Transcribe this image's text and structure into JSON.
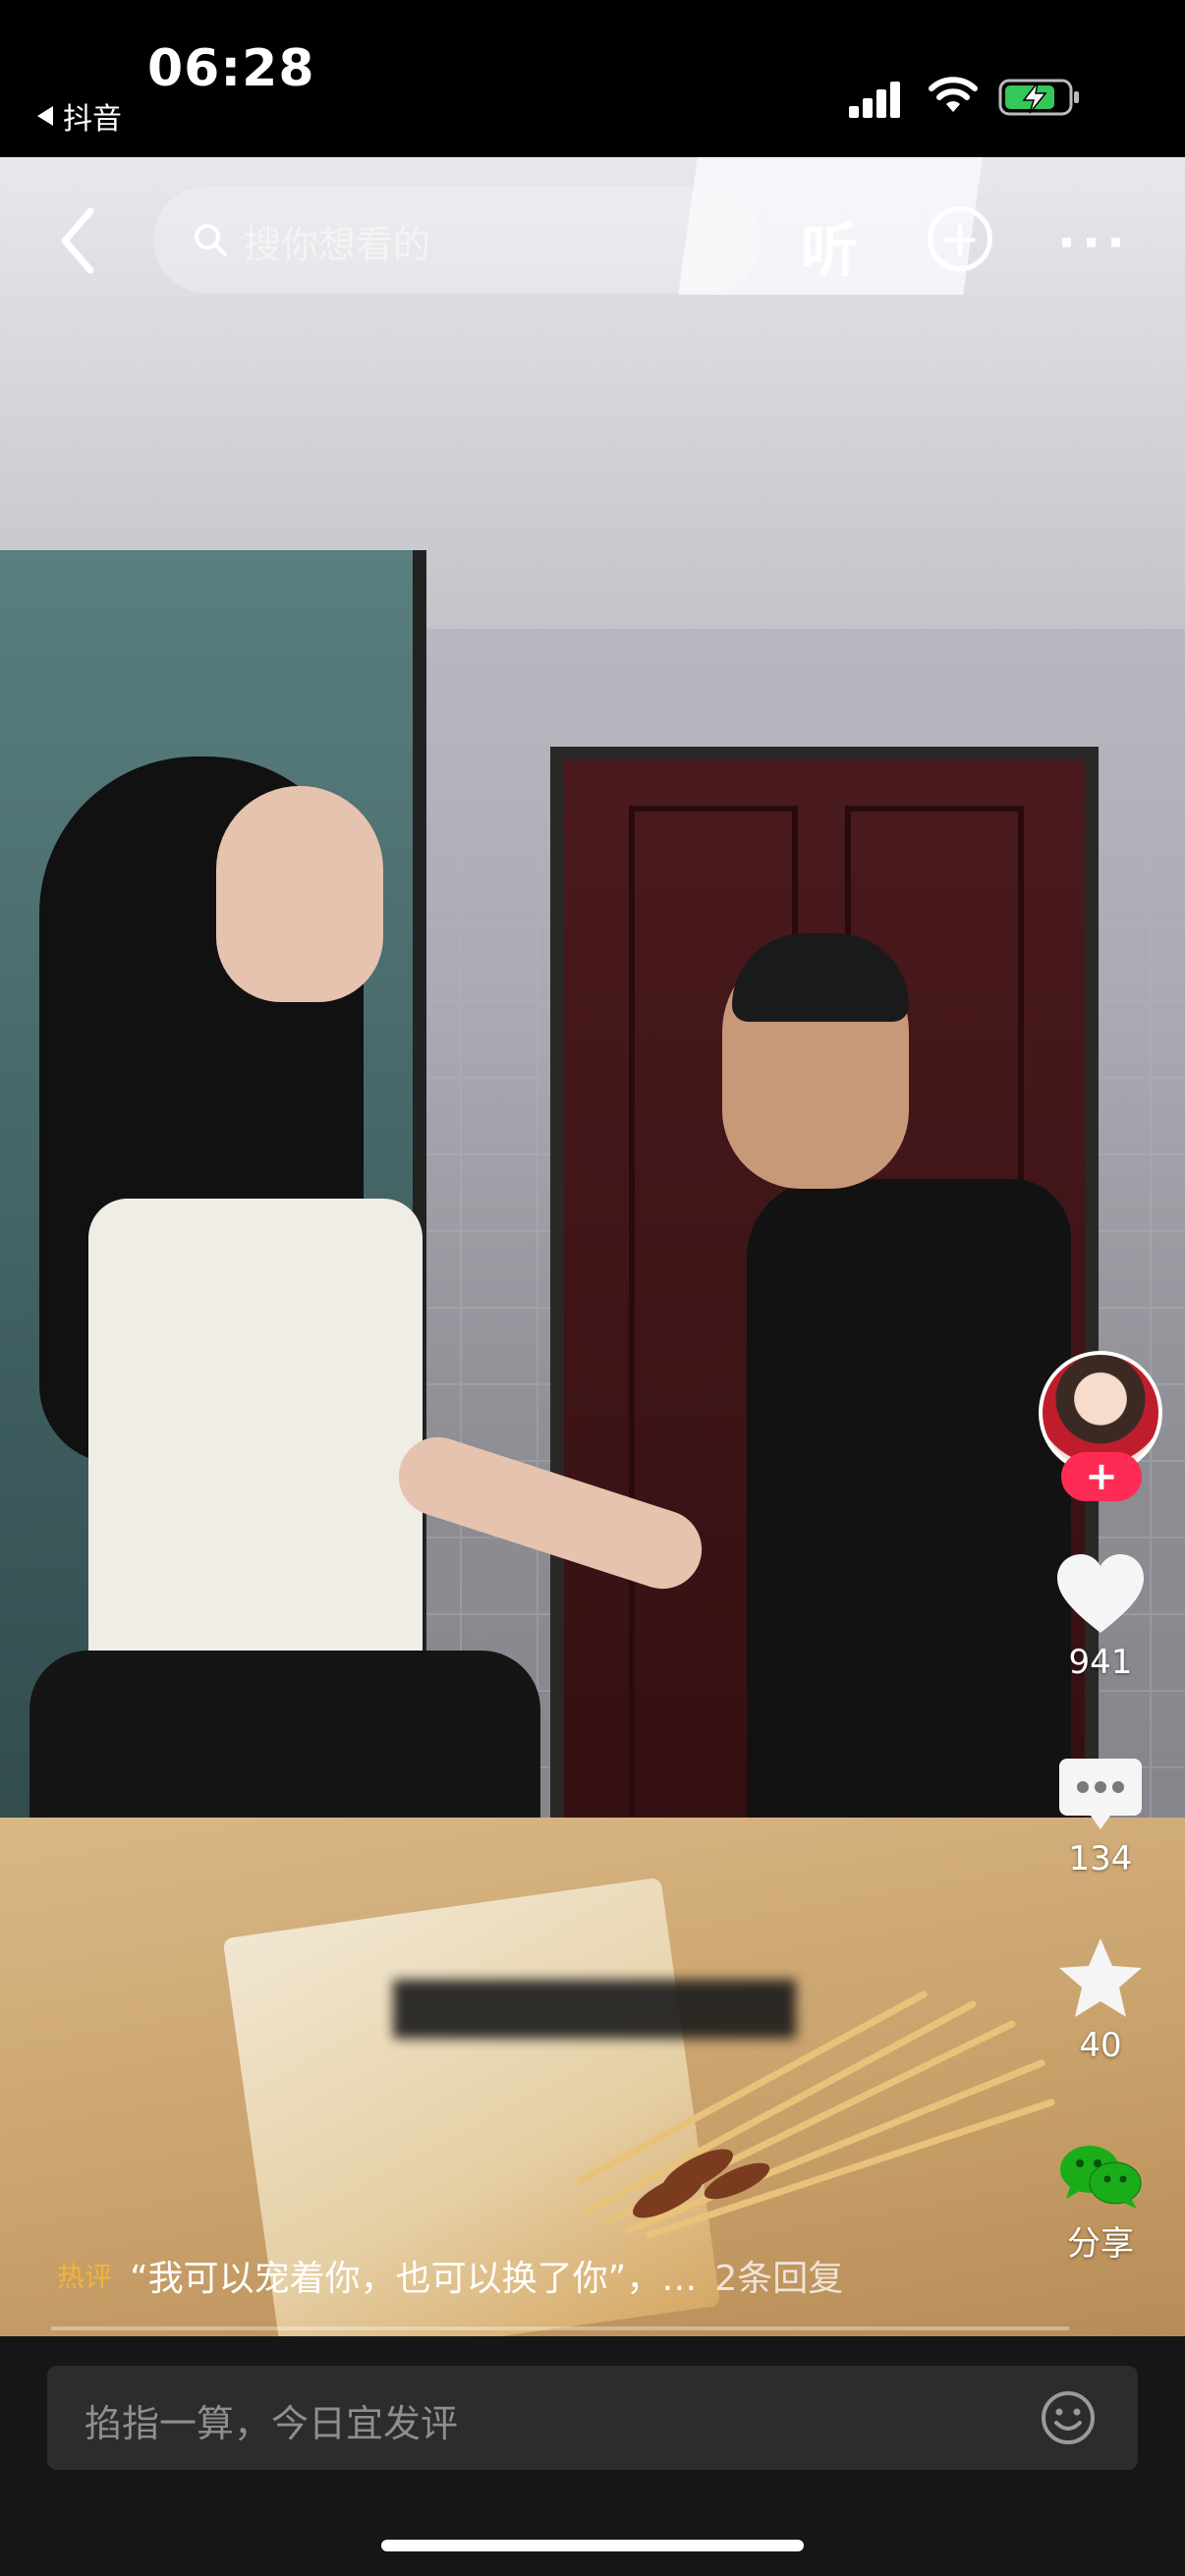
{
  "status_bar": {
    "time": "06:28",
    "back_app": "抖音"
  },
  "top_bar": {
    "search_placeholder": "搜你想看的",
    "listen_label": "听",
    "add_label": "+",
    "more_label": "···"
  },
  "right_rail": {
    "follow_label": "+",
    "like_count": "941",
    "comment_count": "134",
    "favorite_count": "40",
    "share_label": "分享"
  },
  "hot_comment": {
    "tag": "热评",
    "text": "“我可以宠着你，也可以换了你”，…",
    "reply": "2条回复"
  },
  "comment_input": {
    "placeholder": "掐指一算，今日宜发评"
  },
  "colors": {
    "follow_red": "#fe2c55",
    "input_bg": "#2c2c2c"
  }
}
